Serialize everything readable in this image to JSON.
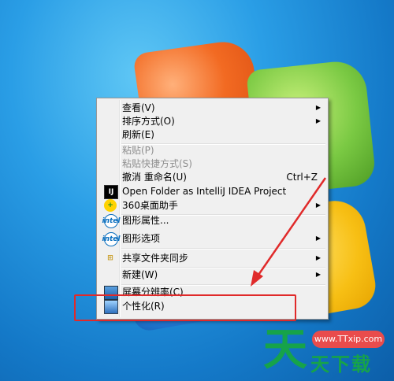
{
  "menu": {
    "items": [
      {
        "label": "查看(V)",
        "has_submenu": true
      },
      {
        "label": "排序方式(O)",
        "has_submenu": true
      },
      {
        "label": "刷新(E)"
      },
      {
        "label": "粘贴(P)",
        "disabled": true
      },
      {
        "label": "粘贴快捷方式(S)",
        "disabled": true
      },
      {
        "label": "撤消 重命名(U)",
        "shortcut": "Ctrl+Z"
      },
      {
        "label": "Open Folder as IntelliJ IDEA Project",
        "icon": "intellij-icon"
      },
      {
        "label": "360桌面助手",
        "icon": "360-icon",
        "has_submenu": true
      },
      {
        "label": "图形属性...",
        "icon": "intel-icon"
      },
      {
        "label": "图形选项",
        "icon": "intel-icon",
        "has_submenu": true
      },
      {
        "label": "共享文件夹同步",
        "icon": "share-sync-icon",
        "has_submenu": true
      },
      {
        "label": "新建(W)",
        "has_submenu": true
      },
      {
        "label": "屏幕分辨率(C)",
        "icon": "screen-resolution-icon"
      },
      {
        "label": "个性化(R)",
        "icon": "personalize-icon"
      }
    ]
  },
  "watermark": {
    "url": "www.TTxip.com",
    "glyph": "天",
    "text": "天下载"
  },
  "colors": {
    "highlight": "#e02a2a",
    "watermark_green": "#16a34a",
    "watermark_red": "#e94c4c"
  }
}
